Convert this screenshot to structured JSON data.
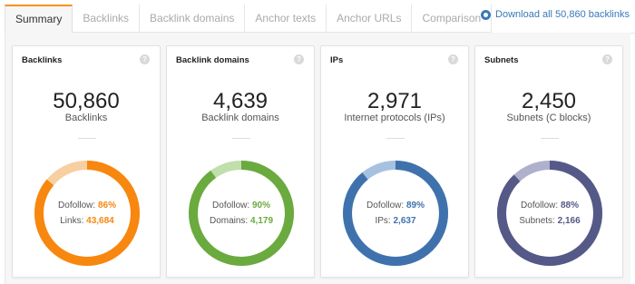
{
  "tabs": [
    "Summary",
    "Backlinks",
    "Backlink domains",
    "Anchor texts",
    "Anchor URLs",
    "Comparison"
  ],
  "download_label": "Download all 50,860 backlinks",
  "help_glyph": "?",
  "cards": [
    {
      "title": "Backlinks",
      "value": "50,860",
      "subtitle": "Backlinks",
      "legend1_label": "Dofollow:",
      "legend1_value": "86%",
      "legend2_label": "Links:",
      "legend2_value": "43,684",
      "fraction": 0.86,
      "main_color": "#f7870e",
      "light_color": "#f8cfa0"
    },
    {
      "title": "Backlink domains",
      "value": "4,639",
      "subtitle": "Backlink domains",
      "legend1_label": "Dofollow:",
      "legend1_value": "90%",
      "legend2_label": "Domains:",
      "legend2_value": "4,179",
      "fraction": 0.9,
      "main_color": "#6aaa3f",
      "light_color": "#c0dfab"
    },
    {
      "title": "IPs",
      "value": "2,971",
      "subtitle": "Internet protocols (IPs)",
      "legend1_label": "Dofollow:",
      "legend1_value": "89%",
      "legend2_label": "IPs:",
      "legend2_value": "2,637",
      "fraction": 0.89,
      "main_color": "#3f72ad",
      "light_color": "#a6c2e0"
    },
    {
      "title": "Subnets",
      "value": "2,450",
      "subtitle": "Subnets (C blocks)",
      "legend1_label": "Dofollow:",
      "legend1_value": "88%",
      "legend2_label": "Subnets:",
      "legend2_value": "2,166",
      "fraction": 0.88,
      "main_color": "#545987",
      "light_color": "#aeb0cc"
    }
  ]
}
